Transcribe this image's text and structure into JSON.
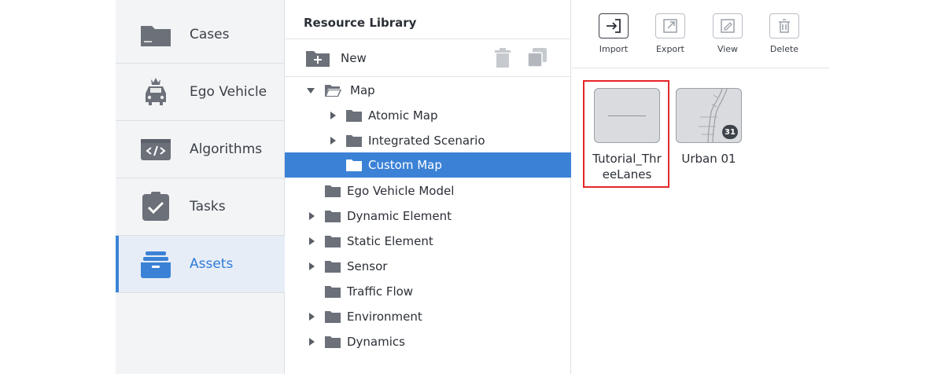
{
  "nav": {
    "items": [
      {
        "label": "Cases",
        "icon": "folder-icon"
      },
      {
        "label": "Ego Vehicle",
        "icon": "car-crown-icon"
      },
      {
        "label": "Algorithms",
        "icon": "code-icon"
      },
      {
        "label": "Tasks",
        "icon": "task-check-icon"
      },
      {
        "label": "Assets",
        "icon": "assets-box-icon",
        "active": true
      }
    ]
  },
  "library": {
    "title": "Resource Library",
    "new_label": "New",
    "tree": [
      {
        "label": "Map",
        "expanded": true
      },
      {
        "label": "Atomic Map"
      },
      {
        "label": "Integrated Scenario"
      },
      {
        "label": "Custom Map",
        "selected": true
      },
      {
        "label": "Ego Vehicle Model"
      },
      {
        "label": "Dynamic Element"
      },
      {
        "label": "Static Element"
      },
      {
        "label": "Sensor"
      },
      {
        "label": "Traffic Flow"
      },
      {
        "label": "Environment"
      },
      {
        "label": "Dynamics"
      }
    ]
  },
  "toolbar": {
    "import_label": "Import",
    "export_label": "Export",
    "view_label": "View",
    "delete_label": "Delete"
  },
  "assets": [
    {
      "name": "Tutorial_ThreeLanes",
      "selected": true
    },
    {
      "name": "Urban 01",
      "badge": "31"
    }
  ],
  "colors": {
    "accent": "#3b82d6",
    "highlight": "#e5262a"
  }
}
